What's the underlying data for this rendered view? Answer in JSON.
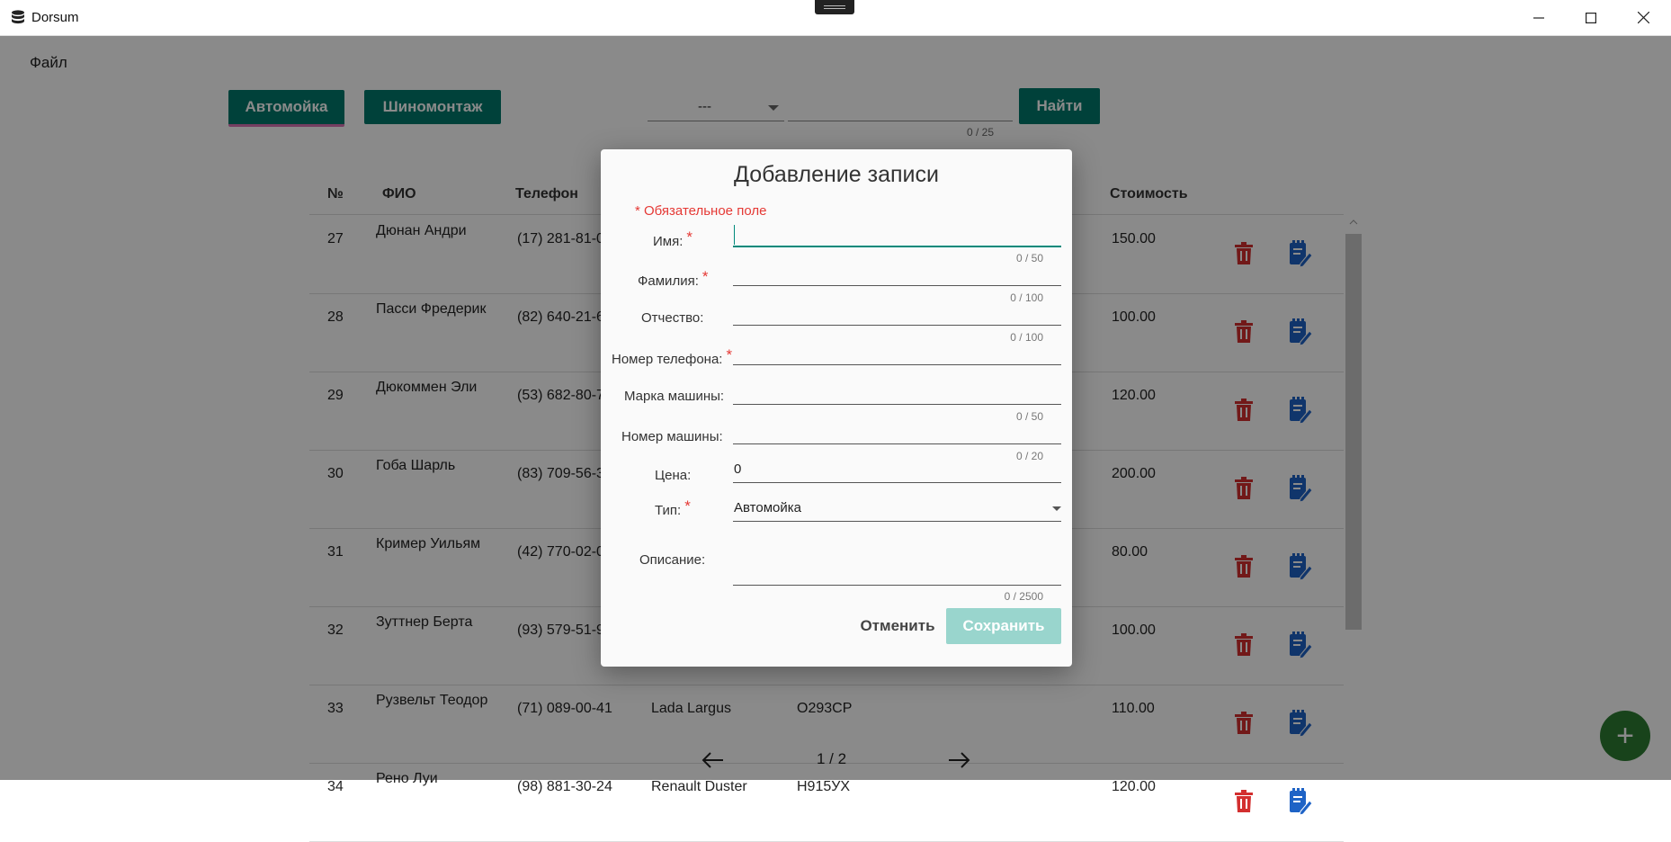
{
  "window": {
    "title": "Dorsum"
  },
  "menu": {
    "file": "Файл"
  },
  "toolbar": {
    "tab_carwash": "Автомойка",
    "tab_tires": "Шиномонтаж",
    "filter_value": "---",
    "search_value": "",
    "search_counter": "0 / 25",
    "find_button": "Найти"
  },
  "table": {
    "headers": {
      "num": "№",
      "fio": "ФИО",
      "phone": "Телефон",
      "cost": "Стоимость"
    },
    "rows": [
      {
        "num": "27",
        "fio": "Дюнан Андри",
        "phone": "(17) 281-81-0",
        "car": "",
        "plate": "",
        "cost": "150.00"
      },
      {
        "num": "28",
        "fio": "Пасси Фредерик",
        "phone": "(82) 640-21-6",
        "car": "",
        "plate": "",
        "cost": "100.00"
      },
      {
        "num": "29",
        "fio": "Дюкоммен Эли",
        "phone": "(53) 682-80-7",
        "car": "",
        "plate": "",
        "cost": "120.00"
      },
      {
        "num": "30",
        "fio": "Гоба Шарль",
        "phone": "(83) 709-56-3",
        "car": "",
        "plate": "",
        "cost": "200.00"
      },
      {
        "num": "31",
        "fio": "Кример Уильям",
        "phone": "(42) 770-02-0",
        "car": "",
        "plate": "",
        "cost": "80.00"
      },
      {
        "num": "32",
        "fio": "Зуттнер Берта",
        "phone": "(93) 579-51-9",
        "car": "",
        "plate": "",
        "cost": "100.00"
      },
      {
        "num": "33",
        "fio": "Рузвельт Теодор",
        "phone": "(71) 089-00-41",
        "car": "Lada Largus",
        "plate": "О293СР",
        "cost": "110.00"
      },
      {
        "num": "34",
        "fio": "Рено Луи",
        "phone": "(98) 881-30-24",
        "car": "Renault Duster",
        "plate": "Н915УХ",
        "cost": "120.00"
      }
    ]
  },
  "pagination": {
    "text": "1 / 2"
  },
  "dialog": {
    "title": "Добавление записи",
    "required_note": "* Обязательное поле",
    "required_mark": "*",
    "fields": {
      "first_name": {
        "label": "Имя:",
        "value": "",
        "counter": "0 / 50"
      },
      "last_name": {
        "label": "Фамилия:",
        "value": "",
        "counter": "0 / 100"
      },
      "patronymic": {
        "label": "Отчество:",
        "value": "",
        "counter": "0 / 100"
      },
      "phone": {
        "label": "Номер телефона:",
        "value": ""
      },
      "car_brand": {
        "label": "Марка машины:",
        "value": "",
        "counter": "0 / 50"
      },
      "car_number": {
        "label": "Номер машины:",
        "value": "",
        "counter": "0 / 20"
      },
      "price": {
        "label": "Цена:",
        "value": "0"
      },
      "type": {
        "label": "Тип:",
        "value": "Автомойка"
      },
      "description": {
        "label": "Описание:",
        "value": "",
        "counter": "0 / 2500"
      }
    },
    "cancel_button": "Отменить",
    "save_button": "Сохранить"
  },
  "colors": {
    "primary": "#00796b",
    "required": "#e53935",
    "delete_icon": "#d32f2f",
    "edit_icon": "#1e63c6",
    "save_disabled": "#99d5cd"
  },
  "icons": {
    "delete": "trash-icon",
    "edit": "edit-note-icon",
    "fab": "plus-icon",
    "prev": "arrow-left-icon",
    "next": "arrow-right-icon",
    "app": "database-icon"
  }
}
